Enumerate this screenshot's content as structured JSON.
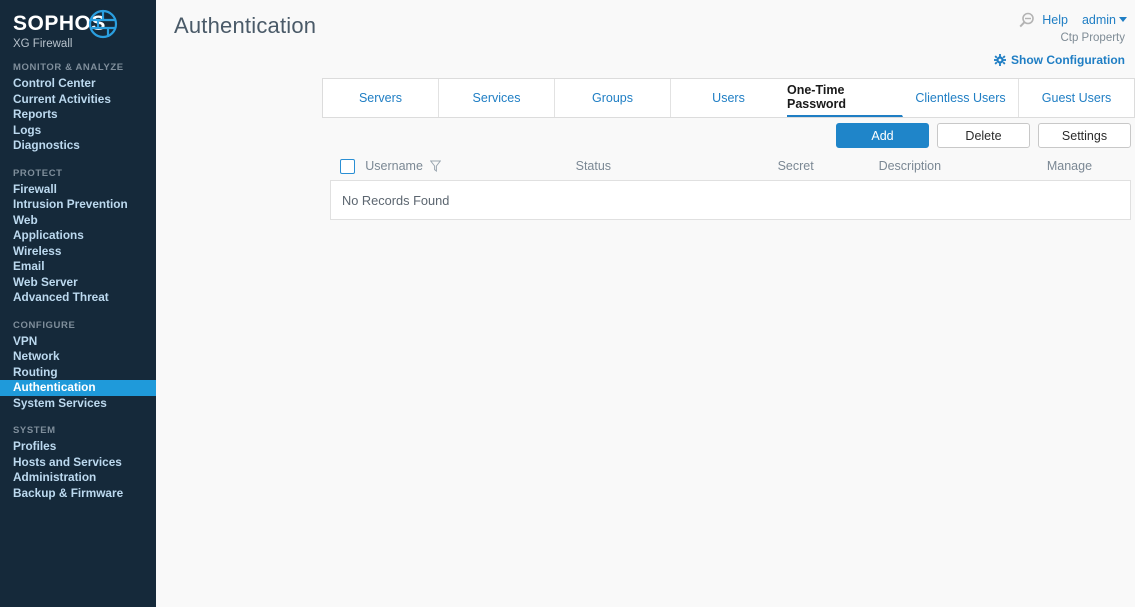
{
  "brand": {
    "name": "SOPHOS",
    "product": "XG Firewall",
    "logo_icon": "globe-grid-icon"
  },
  "sidebar": {
    "groups": [
      {
        "label": "MONITOR & ANALYZE",
        "items": [
          {
            "label": "Control Center",
            "active": false
          },
          {
            "label": "Current Activities",
            "active": false
          },
          {
            "label": "Reports",
            "active": false
          },
          {
            "label": "Logs",
            "active": false
          },
          {
            "label": "Diagnostics",
            "active": false
          }
        ]
      },
      {
        "label": "PROTECT",
        "items": [
          {
            "label": "Firewall",
            "active": false
          },
          {
            "label": "Intrusion Prevention",
            "active": false
          },
          {
            "label": "Web",
            "active": false
          },
          {
            "label": "Applications",
            "active": false
          },
          {
            "label": "Wireless",
            "active": false
          },
          {
            "label": "Email",
            "active": false
          },
          {
            "label": "Web Server",
            "active": false
          },
          {
            "label": "Advanced Threat",
            "active": false
          }
        ]
      },
      {
        "label": "CONFIGURE",
        "items": [
          {
            "label": "VPN",
            "active": false
          },
          {
            "label": "Network",
            "active": false
          },
          {
            "label": "Routing",
            "active": false
          },
          {
            "label": "Authentication",
            "active": true
          },
          {
            "label": "System Services",
            "active": false
          }
        ]
      },
      {
        "label": "SYSTEM",
        "items": [
          {
            "label": "Profiles",
            "active": false
          },
          {
            "label": "Hosts and Services",
            "active": false
          },
          {
            "label": "Administration",
            "active": false
          },
          {
            "label": "Backup & Firmware",
            "active": false
          }
        ]
      }
    ]
  },
  "header": {
    "title": "Authentication",
    "search_icon": "search-icon",
    "help_label": "Help",
    "admin_label": "admin",
    "account_name": "Ctp Property",
    "show_configuration_label": "Show Configuration",
    "gear_icon": "gear-icon"
  },
  "tabs": [
    {
      "label": "Servers",
      "active": false
    },
    {
      "label": "Services",
      "active": false
    },
    {
      "label": "Groups",
      "active": false
    },
    {
      "label": "Users",
      "active": false
    },
    {
      "label": "One-Time Password",
      "active": true
    },
    {
      "label": "Clientless Users",
      "active": false
    },
    {
      "label": "Guest Users",
      "active": false
    }
  ],
  "actions": {
    "add_label": "Add",
    "delete_label": "Delete",
    "settings_label": "Settings"
  },
  "table": {
    "columns": [
      {
        "label": "Username",
        "filterable": true
      },
      {
        "label": "Status",
        "filterable": false
      },
      {
        "label": "Secret",
        "filterable": false
      },
      {
        "label": "Description",
        "filterable": false
      },
      {
        "label": "Manage",
        "filterable": false
      }
    ],
    "filter_icon": "filter-funnel-icon",
    "select_all_checkbox": false,
    "rows": [],
    "empty_message": "No Records Found"
  },
  "colors": {
    "sidebar_bg": "#15293a",
    "sidebar_active": "#1f9ada",
    "link_blue": "#1f7ec4",
    "primary_button": "#1f85c9",
    "content_bg": "#f9f9f9"
  }
}
